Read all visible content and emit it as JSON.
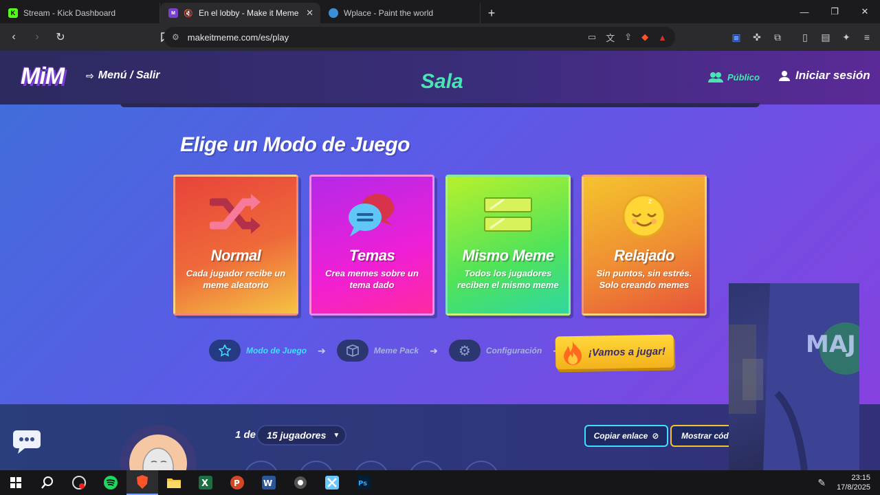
{
  "browser": {
    "tabs": [
      {
        "title": "Stream - Kick Dashboard",
        "active": false
      },
      {
        "title": "En el lobby - Make it Meme",
        "active": true
      },
      {
        "title": "Wplace - Paint the world",
        "active": false
      }
    ],
    "url": "makeitmeme.com/es/play"
  },
  "header": {
    "logo": "MiM",
    "menu": "Menú / Salir",
    "room_title": "Sala",
    "visibility": "Público",
    "login": "Iniciar sesión"
  },
  "main": {
    "title": "Elige un Modo de Juego",
    "modes": [
      {
        "name": "Normal",
        "desc": "Cada jugador recibe un meme aleatorio",
        "icon": "shuffle-icon"
      },
      {
        "name": "Temas",
        "desc": "Crea memes sobre un tema dado",
        "icon": "chat-bubbles-icon"
      },
      {
        "name": "Mismo Meme",
        "desc": "Todos los jugadores reciben el mismo meme",
        "icon": "equal-icon"
      },
      {
        "name": "Relajado",
        "desc": "Sin puntos, sin estrés. Solo creando memes",
        "icon": "sleepy-face-icon"
      }
    ],
    "steps": [
      {
        "label": "Modo de Juego",
        "active": true
      },
      {
        "label": "Meme Pack",
        "active": false
      },
      {
        "label": "Configuración",
        "active": false
      }
    ],
    "play_button": "¡Vamos a jugar!"
  },
  "lobby": {
    "count_prefix": "1 de",
    "player_limit": "15 jugadores",
    "copy_link": "Copiar enlace",
    "show_code": "Mostrar código"
  },
  "taskbar": {
    "time": "23:15",
    "date": "17/8/2025"
  },
  "colors": {
    "accent_teal": "#49e6b4",
    "accent_cyan": "#3fdfff",
    "play_yellow": "#ffd83a"
  }
}
